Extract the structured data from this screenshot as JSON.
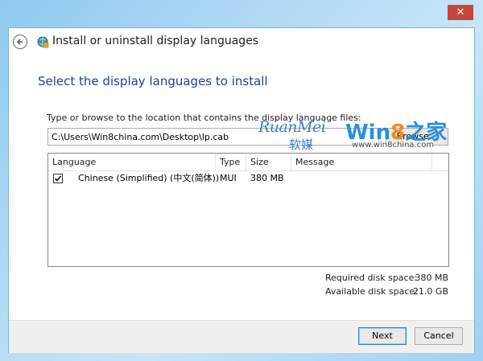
{
  "window": {
    "close_glyph": "✕",
    "title": "Install or uninstall display languages",
    "back_icon": "back-arrow-icon",
    "app_icon": "language-globe-icon"
  },
  "main": {
    "heading": "Select the display languages to install",
    "prompt": "Type or browse to the location that contains the display language files:",
    "path_value": "C:\\Users\\Win8china.com\\Desktop\\lp.cab",
    "browse_label": "Browse..."
  },
  "watermark": {
    "ruanmei": "RuanMei",
    "ruanmei_cn": "软媒",
    "win8_prefix": "Win",
    "win8_digit": "8",
    "win8_suffix": "之家",
    "url": "www.win8china.com"
  },
  "table": {
    "columns": [
      "Language",
      "Type",
      "Size",
      "Message"
    ],
    "rows": [
      {
        "checked": true,
        "language": "Chinese (Simplified) (中文(简体))",
        "type": "MUI",
        "size": "380 MB",
        "message": ""
      }
    ]
  },
  "disk": {
    "required_label": "Required disk space:",
    "required_value": "380 MB",
    "available_label": "Available disk space:",
    "available_value": "21.0 GB"
  },
  "footer": {
    "next_label": "Next",
    "cancel_label": "Cancel"
  },
  "colors": {
    "heading": "#1a3fa6",
    "close_button": "#c7463a",
    "accent_border": "#3c7fb1"
  }
}
